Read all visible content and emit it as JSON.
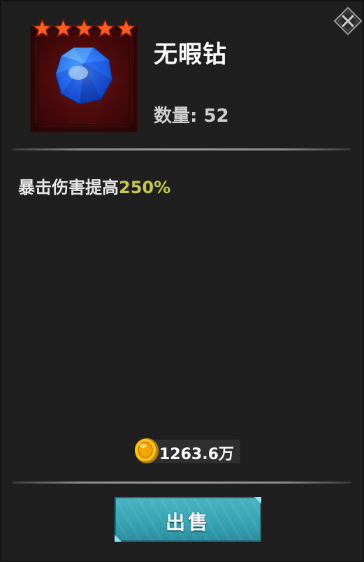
{
  "item": {
    "name": "无暇钻",
    "quantity_text": "数量: 52",
    "stars": 5,
    "icon": "blue-diamond-gem",
    "description_prefix": "暴击伤害提高",
    "description_value": "250%"
  },
  "price": {
    "amount_text": "1263.6万",
    "currency_icon": "gold-coin-icon"
  },
  "actions": {
    "sell_label": "出售",
    "close_icon": "close-icon"
  },
  "colors": {
    "panel_bg": "#1f1f1f",
    "highlight": "#c9c94a",
    "star": "#ff5a1f",
    "frame": "#5a0f0f",
    "sell_button": "#36a4b5"
  }
}
